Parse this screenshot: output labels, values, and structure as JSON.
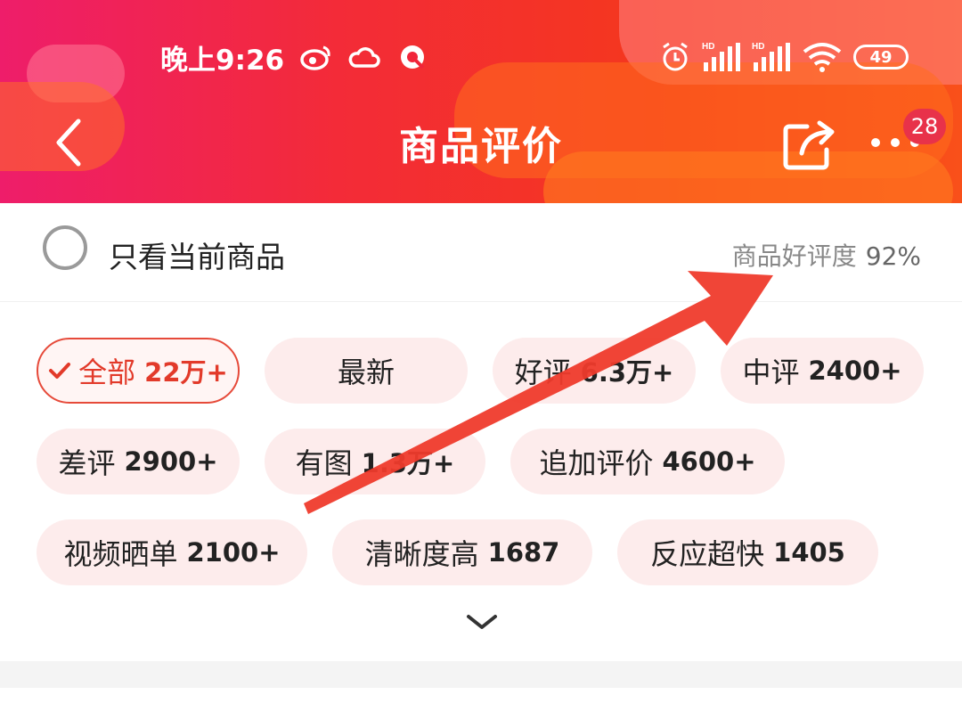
{
  "status_bar": {
    "time": "晚上9:26",
    "icons_left": [
      "weibo-icon",
      "cloud-icon",
      "q-icon"
    ],
    "icons_right": [
      "alarm-icon",
      "signal-hd-icon",
      "signal-hd-icon",
      "wifi-icon"
    ],
    "hd_label": "HD",
    "battery": "49"
  },
  "navbar": {
    "title": "商品评价",
    "badge_count": "28"
  },
  "filter": {
    "only_current_label": "只看当前商品",
    "rating_label": "商品好评度",
    "rating_value": "92%"
  },
  "tags": [
    {
      "label": "全部",
      "count": "22万+",
      "active": true
    },
    {
      "label": "最新",
      "count": "",
      "active": false
    },
    {
      "label": "好评",
      "count": "6.3万+",
      "active": false
    },
    {
      "label": "中评",
      "count": "2400+",
      "active": false
    },
    {
      "label": "差评",
      "count": "2900+",
      "active": false
    },
    {
      "label": "有图",
      "count": "1.3万+",
      "active": false
    },
    {
      "label": "追加评价",
      "count": "4600+",
      "active": false
    },
    {
      "label": "视频晒单",
      "count": "2100+",
      "active": false
    },
    {
      "label": "清晰度高",
      "count": "1687",
      "active": false
    },
    {
      "label": "反应超快",
      "count": "1405",
      "active": false
    }
  ],
  "colors": {
    "header_start": "#ee1d6a",
    "header_end": "#f9501a",
    "active_tag": "#e23a2a",
    "tag_bg": "#fdecec",
    "annotation_arrow": "#ef3b2c"
  }
}
